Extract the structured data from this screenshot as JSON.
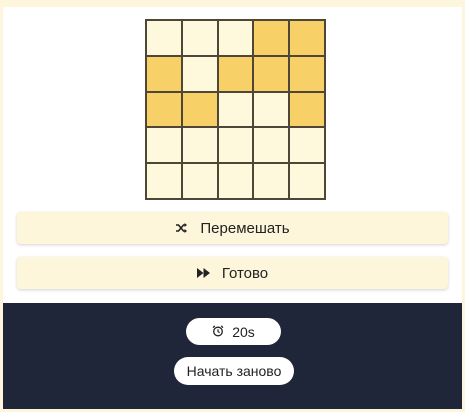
{
  "puzzle": {
    "rows": 5,
    "cols": 5,
    "cells": [
      [
        0,
        0,
        0,
        1,
        1
      ],
      [
        1,
        0,
        1,
        1,
        1
      ],
      [
        1,
        1,
        0,
        0,
        1
      ],
      [
        0,
        0,
        0,
        0,
        0
      ],
      [
        0,
        0,
        0,
        0,
        0
      ]
    ],
    "filled_color": "#f8d068",
    "empty_color": "#fef8dd"
  },
  "actions": {
    "shuffle": {
      "label": "Перемешать",
      "icon": "shuffle-icon"
    },
    "done": {
      "label": "Готово",
      "icon": "fast-forward-icon"
    }
  },
  "footer": {
    "timer": {
      "value": "20s",
      "icon": "alarm-clock-icon"
    },
    "restart_label": "Начать заново"
  },
  "colors": {
    "background": "#fdf6dc",
    "footer": "#20263a",
    "button": "#fdf6db"
  }
}
